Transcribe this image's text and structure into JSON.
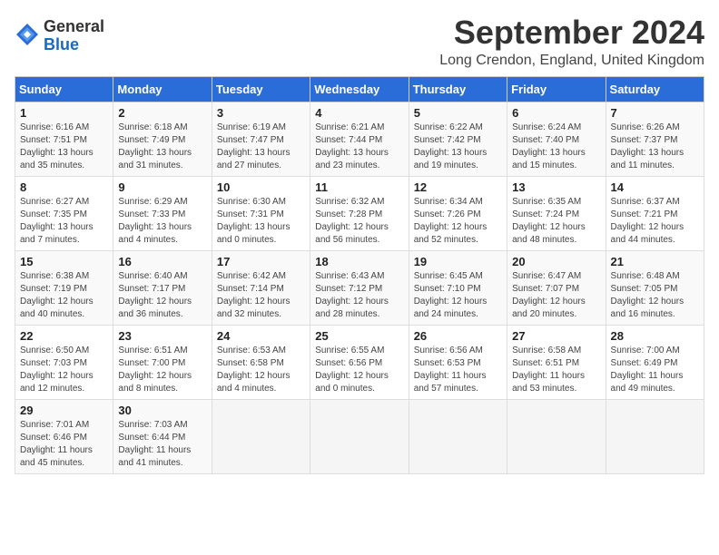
{
  "header": {
    "logo_general": "General",
    "logo_blue": "Blue",
    "month_title": "September 2024",
    "location": "Long Crendon, England, United Kingdom"
  },
  "days_of_week": [
    "Sunday",
    "Monday",
    "Tuesday",
    "Wednesday",
    "Thursday",
    "Friday",
    "Saturday"
  ],
  "weeks": [
    [
      {
        "day": "1",
        "info": "Sunrise: 6:16 AM\nSunset: 7:51 PM\nDaylight: 13 hours and 35 minutes."
      },
      {
        "day": "2",
        "info": "Sunrise: 6:18 AM\nSunset: 7:49 PM\nDaylight: 13 hours and 31 minutes."
      },
      {
        "day": "3",
        "info": "Sunrise: 6:19 AM\nSunset: 7:47 PM\nDaylight: 13 hours and 27 minutes."
      },
      {
        "day": "4",
        "info": "Sunrise: 6:21 AM\nSunset: 7:44 PM\nDaylight: 13 hours and 23 minutes."
      },
      {
        "day": "5",
        "info": "Sunrise: 6:22 AM\nSunset: 7:42 PM\nDaylight: 13 hours and 19 minutes."
      },
      {
        "day": "6",
        "info": "Sunrise: 6:24 AM\nSunset: 7:40 PM\nDaylight: 13 hours and 15 minutes."
      },
      {
        "day": "7",
        "info": "Sunrise: 6:26 AM\nSunset: 7:37 PM\nDaylight: 13 hours and 11 minutes."
      }
    ],
    [
      {
        "day": "8",
        "info": "Sunrise: 6:27 AM\nSunset: 7:35 PM\nDaylight: 13 hours and 7 minutes."
      },
      {
        "day": "9",
        "info": "Sunrise: 6:29 AM\nSunset: 7:33 PM\nDaylight: 13 hours and 4 minutes."
      },
      {
        "day": "10",
        "info": "Sunrise: 6:30 AM\nSunset: 7:31 PM\nDaylight: 13 hours and 0 minutes."
      },
      {
        "day": "11",
        "info": "Sunrise: 6:32 AM\nSunset: 7:28 PM\nDaylight: 12 hours and 56 minutes."
      },
      {
        "day": "12",
        "info": "Sunrise: 6:34 AM\nSunset: 7:26 PM\nDaylight: 12 hours and 52 minutes."
      },
      {
        "day": "13",
        "info": "Sunrise: 6:35 AM\nSunset: 7:24 PM\nDaylight: 12 hours and 48 minutes."
      },
      {
        "day": "14",
        "info": "Sunrise: 6:37 AM\nSunset: 7:21 PM\nDaylight: 12 hours and 44 minutes."
      }
    ],
    [
      {
        "day": "15",
        "info": "Sunrise: 6:38 AM\nSunset: 7:19 PM\nDaylight: 12 hours and 40 minutes."
      },
      {
        "day": "16",
        "info": "Sunrise: 6:40 AM\nSunset: 7:17 PM\nDaylight: 12 hours and 36 minutes."
      },
      {
        "day": "17",
        "info": "Sunrise: 6:42 AM\nSunset: 7:14 PM\nDaylight: 12 hours and 32 minutes."
      },
      {
        "day": "18",
        "info": "Sunrise: 6:43 AM\nSunset: 7:12 PM\nDaylight: 12 hours and 28 minutes."
      },
      {
        "day": "19",
        "info": "Sunrise: 6:45 AM\nSunset: 7:10 PM\nDaylight: 12 hours and 24 minutes."
      },
      {
        "day": "20",
        "info": "Sunrise: 6:47 AM\nSunset: 7:07 PM\nDaylight: 12 hours and 20 minutes."
      },
      {
        "day": "21",
        "info": "Sunrise: 6:48 AM\nSunset: 7:05 PM\nDaylight: 12 hours and 16 minutes."
      }
    ],
    [
      {
        "day": "22",
        "info": "Sunrise: 6:50 AM\nSunset: 7:03 PM\nDaylight: 12 hours and 12 minutes."
      },
      {
        "day": "23",
        "info": "Sunrise: 6:51 AM\nSunset: 7:00 PM\nDaylight: 12 hours and 8 minutes."
      },
      {
        "day": "24",
        "info": "Sunrise: 6:53 AM\nSunset: 6:58 PM\nDaylight: 12 hours and 4 minutes."
      },
      {
        "day": "25",
        "info": "Sunrise: 6:55 AM\nSunset: 6:56 PM\nDaylight: 12 hours and 0 minutes."
      },
      {
        "day": "26",
        "info": "Sunrise: 6:56 AM\nSunset: 6:53 PM\nDaylight: 11 hours and 57 minutes."
      },
      {
        "day": "27",
        "info": "Sunrise: 6:58 AM\nSunset: 6:51 PM\nDaylight: 11 hours and 53 minutes."
      },
      {
        "day": "28",
        "info": "Sunrise: 7:00 AM\nSunset: 6:49 PM\nDaylight: 11 hours and 49 minutes."
      }
    ],
    [
      {
        "day": "29",
        "info": "Sunrise: 7:01 AM\nSunset: 6:46 PM\nDaylight: 11 hours and 45 minutes."
      },
      {
        "day": "30",
        "info": "Sunrise: 7:03 AM\nSunset: 6:44 PM\nDaylight: 11 hours and 41 minutes."
      },
      {
        "day": "",
        "info": ""
      },
      {
        "day": "",
        "info": ""
      },
      {
        "day": "",
        "info": ""
      },
      {
        "day": "",
        "info": ""
      },
      {
        "day": "",
        "info": ""
      }
    ]
  ]
}
